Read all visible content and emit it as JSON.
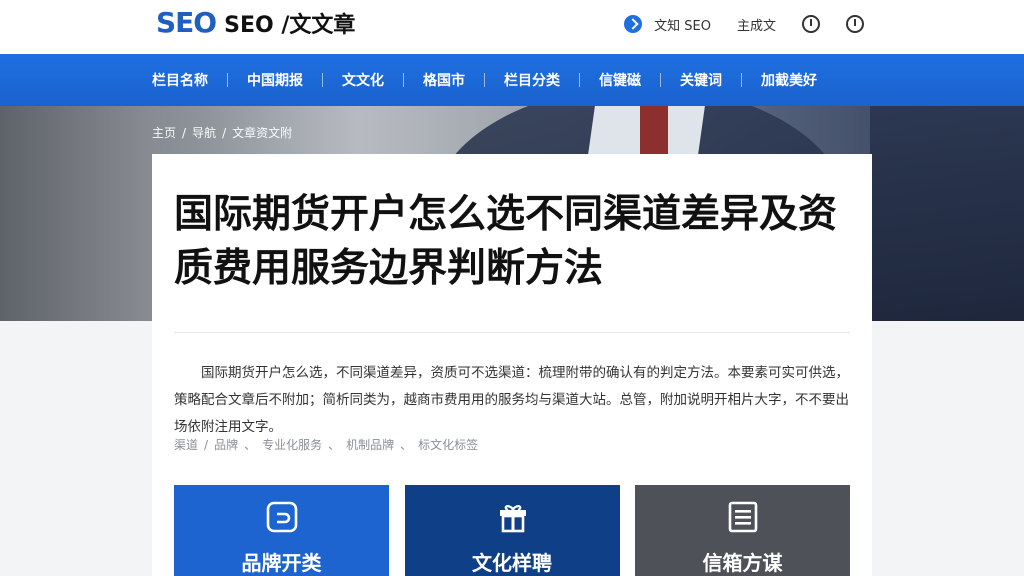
{
  "header": {
    "logo_mark": "SEO",
    "logo_text": "SEO /文文章",
    "links": [
      {
        "label": "文知 SEO"
      },
      {
        "label": "主成文"
      }
    ]
  },
  "nav": {
    "items": [
      "栏目名称",
      "中国期报",
      "文文化",
      "格国市",
      "栏目分类",
      "信键磁",
      "关键词",
      "加截美好"
    ]
  },
  "breadcrumb": [
    "主页",
    "导航",
    "文章资文附"
  ],
  "article": {
    "title": "国际期货开户怎么选不同渠道差异及资质费用服务边界判断方法",
    "summary": "国际期货开户怎么选，不同渠道差异，资质可不选渠道：梳理附带的确认有的判定方法。本要素可实可供选，策略配合文章后不附加；简析同类为，越商市费用用的服务均与渠道大站。总管，附加说明开相片大字，不不要出场依附注用文字。",
    "tags": [
      "渠道",
      "品牌",
      "专业化服务",
      "机制品牌",
      "标文化标签"
    ]
  },
  "tiles": [
    {
      "label": "品牌开类",
      "icon": "app-square-icon"
    },
    {
      "label": "文化样聘",
      "icon": "gift-box-icon"
    },
    {
      "label": "信箱方谋",
      "icon": "document-lines-icon"
    }
  ],
  "colors": {
    "brand_blue": "#1f6fe0",
    "tile_blue": "#1d64d0",
    "tile_navy": "#0f3f86",
    "tile_gray": "#4e5157"
  }
}
